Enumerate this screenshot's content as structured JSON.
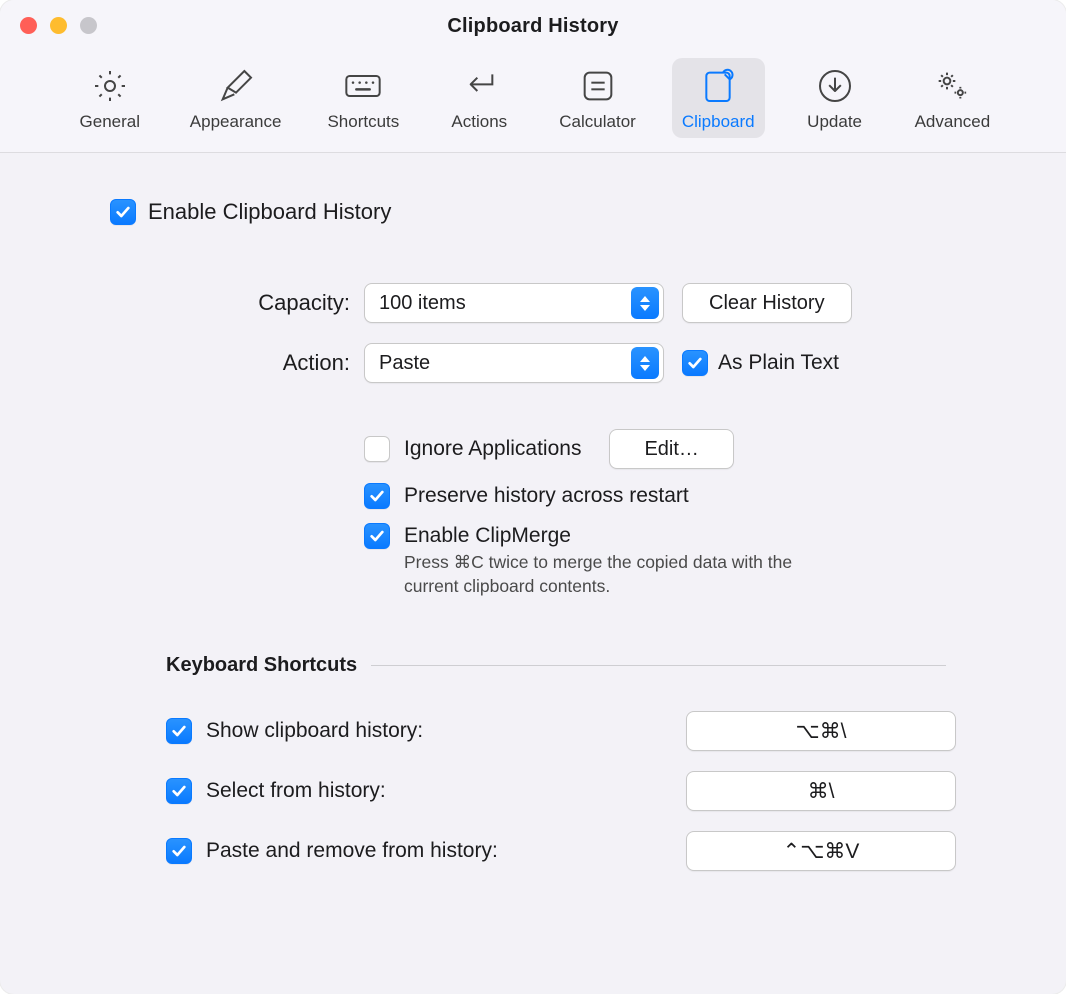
{
  "window": {
    "title": "Clipboard History"
  },
  "toolbar": {
    "tabs": [
      {
        "id": "general",
        "label": "General",
        "icon": "gear-icon",
        "selected": false
      },
      {
        "id": "appearance",
        "label": "Appearance",
        "icon": "paintbrush-icon",
        "selected": false
      },
      {
        "id": "shortcuts",
        "label": "Shortcuts",
        "icon": "keyboard-icon",
        "selected": false
      },
      {
        "id": "actions",
        "label": "Actions",
        "icon": "return-icon",
        "selected": false
      },
      {
        "id": "calculator",
        "label": "Calculator",
        "icon": "equals-icon",
        "selected": false
      },
      {
        "id": "clipboard",
        "label": "Clipboard",
        "icon": "clipboard-icon",
        "selected": true
      },
      {
        "id": "update",
        "label": "Update",
        "icon": "download-icon",
        "selected": false
      },
      {
        "id": "advanced",
        "label": "Advanced",
        "icon": "gears-icon",
        "selected": false
      }
    ]
  },
  "main": {
    "enable_label": "Enable Clipboard History",
    "enable_checked": true,
    "capacity": {
      "label": "Capacity:",
      "value": "100 items"
    },
    "clear_button": "Clear History",
    "action": {
      "label": "Action:",
      "value": "Paste"
    },
    "plain_text": {
      "label": "As Plain Text",
      "checked": true
    },
    "ignore_apps": {
      "label": "Ignore Applications",
      "checked": false
    },
    "edit_button": "Edit…",
    "preserve": {
      "label": "Preserve history across restart",
      "checked": true
    },
    "clipmerge": {
      "label": "Enable ClipMerge",
      "checked": true,
      "description": "Press ⌘C twice to merge the copied data with the current clipboard contents."
    },
    "keyboard_section_title": "Keyboard Shortcuts",
    "shortcuts": [
      {
        "label": "Show clipboard history:",
        "value": "⌥⌘\\",
        "checked": true
      },
      {
        "label": "Select from history:",
        "value": "⌘\\",
        "checked": true
      },
      {
        "label": "Paste and remove from history:",
        "value": "⌃⌥⌘V",
        "checked": true
      }
    ]
  }
}
